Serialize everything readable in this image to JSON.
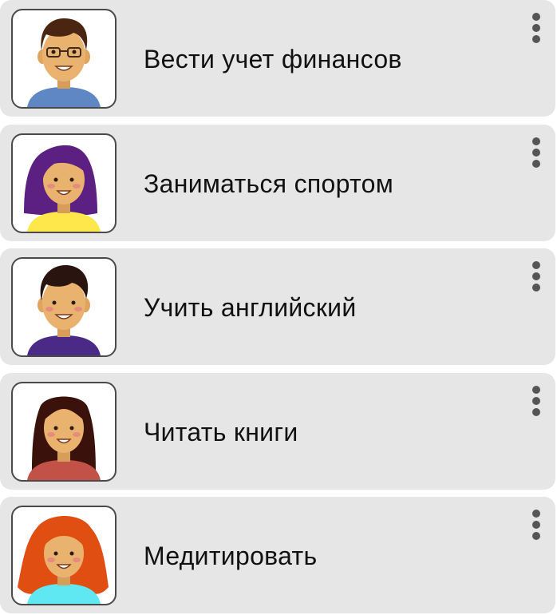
{
  "habits": [
    {
      "title": "Вести учет финансов",
      "avatar_icon": "avatar-man-glasses-icon",
      "colors": {
        "hair": "#4a2612",
        "shirt": "#5f87c4",
        "skin": "#e9b36f"
      }
    },
    {
      "title": "Заниматься спортом",
      "avatar_icon": "avatar-woman-purple-hair-icon",
      "colors": {
        "hair": "#5c1f82",
        "shirt": "#fde74b",
        "skin": "#e9b36f"
      }
    },
    {
      "title": "Учить английский",
      "avatar_icon": "avatar-man-dark-hair-icon",
      "colors": {
        "hair": "#2a1410",
        "shirt": "#4a2a86",
        "skin": "#e9b36f"
      }
    },
    {
      "title": "Читать книги",
      "avatar_icon": "avatar-woman-brown-hair-icon",
      "colors": {
        "hair": "#3a120b",
        "shirt": "#c25248",
        "skin": "#e9b36f"
      }
    },
    {
      "title": "Медитировать",
      "avatar_icon": "avatar-woman-red-hair-icon",
      "colors": {
        "hair": "#e04e12",
        "shirt": "#5fe8f2",
        "skin": "#e9b36f"
      }
    }
  ],
  "card_background": "#e6e6e6",
  "more_menu_icon": "more-vertical-icon"
}
